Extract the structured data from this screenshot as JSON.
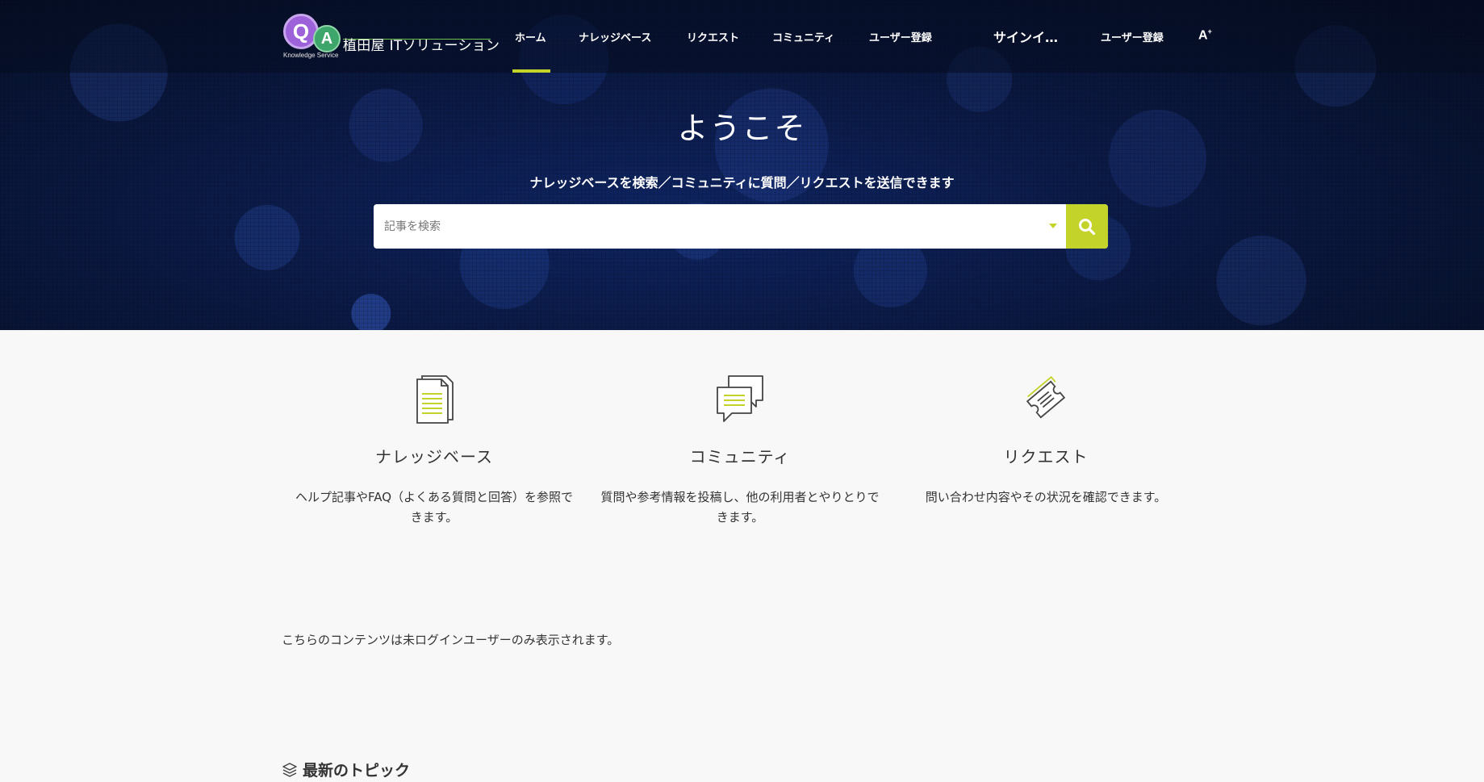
{
  "header": {
    "logo": {
      "q": "Q",
      "a": "A",
      "subtitle": "Knowledge Service",
      "title": "植田屋 ITソリューション"
    },
    "nav": [
      {
        "label": "ホーム",
        "active": true
      },
      {
        "label": "ナレッジベース"
      },
      {
        "label": "リクエスト"
      },
      {
        "label": "コミュニティ"
      },
      {
        "label": "ユーザー登録"
      }
    ],
    "sign_in": "サインイ…",
    "register": "ユーザー登録",
    "a11y": "A",
    "a11y_sup": "+"
  },
  "hero": {
    "title": "ようこそ",
    "subtitle": "ナレッジベースを検索／コミュニティに質問／リクエストを送信できます",
    "search_placeholder": "記事を検索"
  },
  "features": [
    {
      "icon": "document-icon",
      "title": "ナレッジベース",
      "description": "ヘルプ記事やFAQ（よくある質問と回答）を参照できます。"
    },
    {
      "icon": "chat-bubbles-icon",
      "title": "コミュニティ",
      "description": "質問や参考情報を投稿し、他の利用者とやりとりできます。"
    },
    {
      "icon": "ticket-icon",
      "title": "リクエスト",
      "description": "問い合わせ内容やその状況を確認できます。"
    }
  ],
  "notice": "こちらのコンテンツは未ログインユーザーのみ表示されます。",
  "topics": {
    "title": "最新のトピック",
    "icon": "layers-icon"
  },
  "colors": {
    "accent": "#c3d32a",
    "hero_dark": "#081331",
    "logo_purple": "#9d62d9",
    "logo_green": "#3ea66b"
  }
}
